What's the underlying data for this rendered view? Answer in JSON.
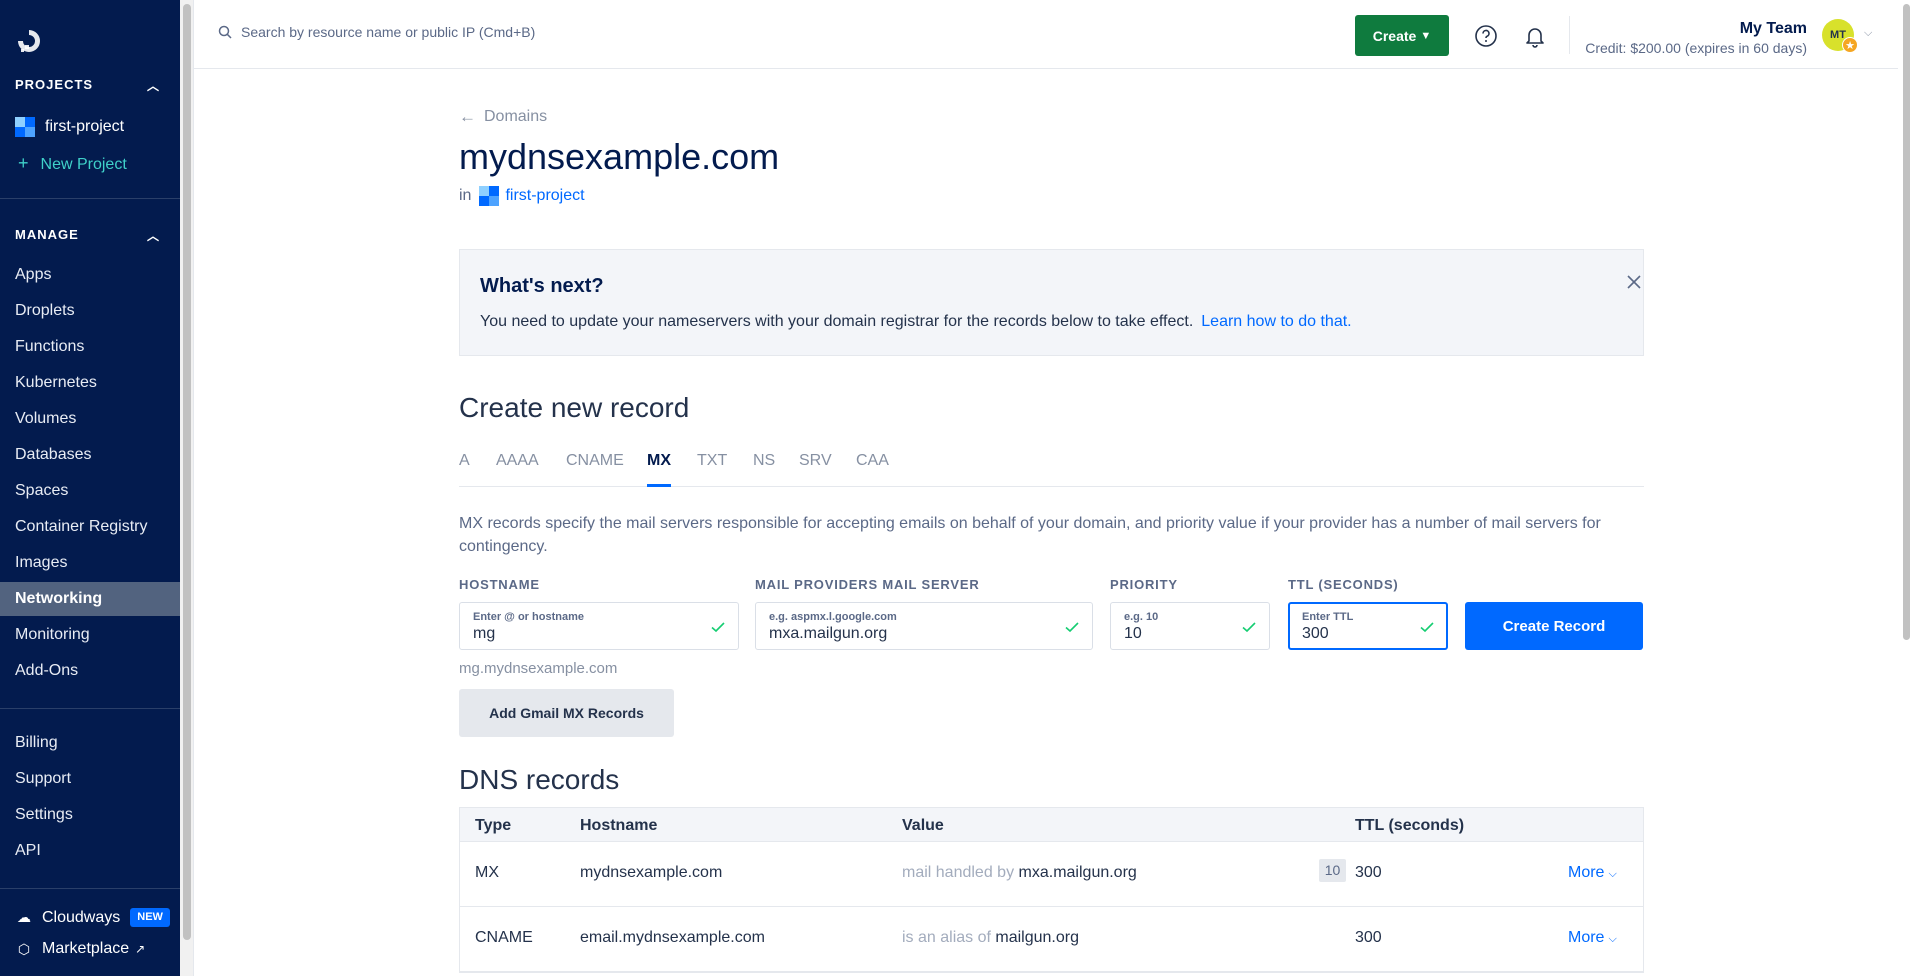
{
  "sidebar": {
    "projects_heading": "PROJECTS",
    "project_name": "first-project",
    "new_project": "New Project",
    "manage_heading": "MANAGE",
    "manage_items": [
      "Apps",
      "Droplets",
      "Functions",
      "Kubernetes",
      "Volumes",
      "Databases",
      "Spaces",
      "Container Registry",
      "Images",
      "Networking",
      "Monitoring",
      "Add-Ons"
    ],
    "active_item": "Networking",
    "account_items": [
      "Billing",
      "Support",
      "Settings",
      "API"
    ],
    "cloudways": "Cloudways",
    "new_badge": "NEW",
    "marketplace": "Marketplace"
  },
  "topbar": {
    "search_placeholder": "Search by resource name or public IP (Cmd+B)",
    "create_label": "Create",
    "team_name": "My Team",
    "credit": "Credit: $200.00 (expires in 60 days)",
    "avatar_initials": "MT"
  },
  "breadcrumb": {
    "back_label": "Domains"
  },
  "domain": {
    "name": "mydnsexample.com",
    "in_label": "in",
    "project": "first-project"
  },
  "whats_next": {
    "title": "What's next?",
    "text": "You need to update your nameservers with your domain registrar for the records below to take effect.",
    "link": "Learn how to do that."
  },
  "create_record": {
    "title": "Create new record",
    "tabs": [
      "A",
      "AAAA",
      "CNAME",
      "MX",
      "TXT",
      "NS",
      "SRV",
      "CAA"
    ],
    "active_tab": "MX",
    "description": "MX records specify the mail servers responsible for accepting emails on behalf of your domain, and priority value if your provider has a number of mail servers for contingency.",
    "fields": {
      "hostname": {
        "label": "HOSTNAME",
        "placeholder": "Enter @ or hostname",
        "value": "mg"
      },
      "mail_server": {
        "label": "MAIL PROVIDERS MAIL SERVER",
        "placeholder": "e.g. aspmx.l.google.com",
        "value": "mxa.mailgun.org"
      },
      "priority": {
        "label": "PRIORITY",
        "placeholder": "e.g. 10",
        "value": "10"
      },
      "ttl": {
        "label": "TTL (SECONDS)",
        "placeholder": "Enter TTL",
        "value": "300"
      }
    },
    "create_button": "Create Record",
    "hostname_preview": "mg.mydnsexample.com",
    "gmail_button": "Add Gmail MX Records"
  },
  "dns_records": {
    "title": "DNS records",
    "columns": [
      "Type",
      "Hostname",
      "Value",
      "TTL (seconds)"
    ],
    "rows": [
      {
        "type": "MX",
        "hostname": "mydnsexample.com",
        "value_prefix": "mail handled by",
        "value": "mxa.mailgun.org",
        "priority": "10",
        "ttl": "300",
        "more": "More"
      },
      {
        "type": "CNAME",
        "hostname": "email.mydnsexample.com",
        "value_prefix": "is an alias of",
        "value": "mailgun.org",
        "priority": "",
        "ttl": "300",
        "more": "More"
      }
    ]
  },
  "colors": {
    "sidebar_bg": "#031b4e",
    "primary": "#0069ff",
    "create_green": "#0f7b3e",
    "accent_teal": "#3fd0c9"
  },
  "icons": [
    "logo-icon",
    "search-icon",
    "help-icon",
    "bell-icon",
    "close-icon",
    "check-icon",
    "chevron-down-icon",
    "chevron-up-icon",
    "plus-icon",
    "arrow-left-icon",
    "cloud-icon",
    "marketplace-icon",
    "external-link-icon"
  ]
}
